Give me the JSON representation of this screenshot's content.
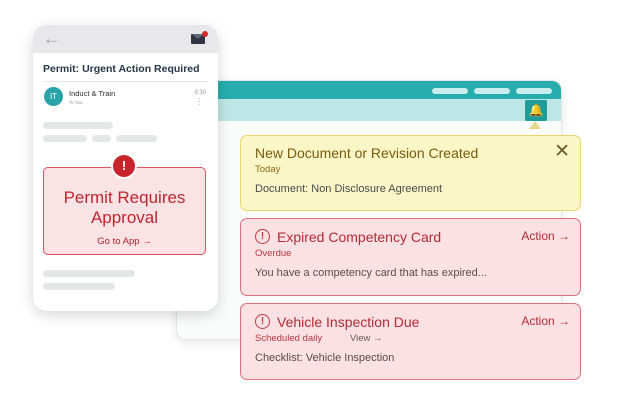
{
  "phone": {
    "subject": "Permit: Urgent Action Required",
    "sender": "Induct & Train",
    "avatar_initials": "IT",
    "to": "To You",
    "time": "9:30",
    "icons": {
      "back": "arrow-left-icon",
      "mail": "envelope-icon",
      "more": "vertical-dots-icon",
      "alert": "exclamation-icon"
    },
    "approval": {
      "title": "Permit Requires Approval",
      "link": "Go to App →"
    }
  },
  "notifications": [
    {
      "type": "info",
      "title": "New Document or Revision Created",
      "subtitle": "Today",
      "body": "Document: Non Disclosure Agreement"
    },
    {
      "type": "alert",
      "title": "Expired Competency Card",
      "subtitle": "Overdue",
      "action": "Action →",
      "body": "You have a competency card that has expired..."
    },
    {
      "type": "alert",
      "title": "Vehicle Inspection Due",
      "subtitle": "Scheduled daily",
      "view": "View →",
      "action": "Action →",
      "body": "Checklist: Vehicle Inspection"
    }
  ],
  "colors": {
    "teal": "#27adad",
    "alert_red": "#c0252d",
    "warning_yellow": "#fbf6c8"
  }
}
